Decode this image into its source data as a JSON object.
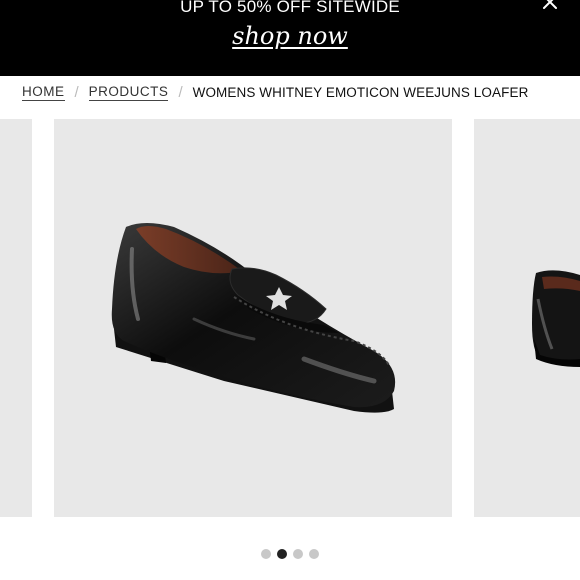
{
  "promo": {
    "text": "UP TO 50% OFF SITEWIDE",
    "link": "shop now",
    "close_icon": "close-icon"
  },
  "breadcrumb": {
    "home": "HOME",
    "products": "PRODUCTS",
    "current": "WOMENS WHITNEY EMOTICON WEEJUNS LOAFER",
    "separator": "/"
  },
  "gallery": {
    "slides": [
      "previous product image",
      "Womens Whitney Emoticon Weejuns Loafer",
      "next product image"
    ],
    "dot_count": 4,
    "active_index": 1
  },
  "colors": {
    "banner": "#000000",
    "slide_bg": "#e8e8e8",
    "dot_active": "#222222",
    "dot_inactive": "#c8c8c8"
  }
}
